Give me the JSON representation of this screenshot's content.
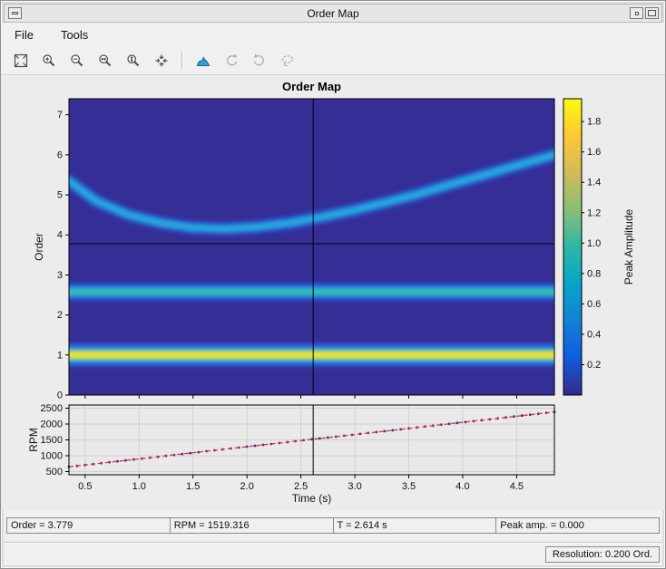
{
  "window": {
    "title": "Order Map"
  },
  "menu": {
    "items": [
      {
        "label": "File"
      },
      {
        "label": "Tools"
      }
    ]
  },
  "toolbar": {
    "buttons": [
      {
        "name": "fit-view",
        "enabled": true
      },
      {
        "name": "zoom-in",
        "enabled": true
      },
      {
        "name": "zoom-out",
        "enabled": true
      },
      {
        "name": "zoom-x",
        "enabled": true
      },
      {
        "name": "zoom-y",
        "enabled": true
      },
      {
        "name": "reset-view",
        "enabled": true
      },
      {
        "name": "colormap",
        "enabled": true
      },
      {
        "name": "rotate-ccw",
        "enabled": false
      },
      {
        "name": "rotate-cw",
        "enabled": false
      },
      {
        "name": "lasso",
        "enabled": false
      }
    ]
  },
  "status": {
    "fields": [
      {
        "name": "order",
        "text": "Order = 3.779"
      },
      {
        "name": "rpm",
        "text": "RPM = 1519.316"
      },
      {
        "name": "time",
        "text": "T = 2.614 s"
      },
      {
        "name": "peak-amp",
        "text": "Peak amp. = 0.000"
      }
    ],
    "resolution": "Resolution: 0.200 Ord."
  },
  "chart_data": [
    {
      "type": "heatmap",
      "title": "Order Map",
      "ylabel": "Order",
      "xlim": [
        0.35,
        4.85
      ],
      "ylim": [
        0,
        7.4
      ],
      "yticks": [
        0,
        1,
        2,
        3,
        4,
        5,
        6,
        7
      ],
      "xticks": [
        0.5,
        1.0,
        1.5,
        2.0,
        2.5,
        3.0,
        3.5,
        4.0,
        4.5
      ],
      "background_color": "#352e96",
      "colorbar": {
        "label": "Peak Amplitude",
        "clim": [
          0,
          1.95
        ],
        "ticks": [
          0.2,
          0.4,
          0.6,
          0.8,
          1.0,
          1.2,
          1.4,
          1.6,
          1.8
        ],
        "colors": [
          "#352a87",
          "#0f5cdd",
          "#1481d6",
          "#06a4ca",
          "#2eb7a4",
          "#87bf77",
          "#d1bb59",
          "#fec832",
          "#f9fb0e"
        ]
      },
      "crosshair": {
        "time": 2.614,
        "order": 3.779
      },
      "features": [
        {
          "kind": "horizontal-band",
          "name": "order-1-fundamental",
          "order": 1.0,
          "peak_amplitude": 1.9,
          "layers": [
            {
              "color": "#2a58d8",
              "width": 26
            },
            {
              "color": "#1fa8d8",
              "width": 16
            },
            {
              "color": "#7ccb4e",
              "width": 10
            },
            {
              "color": "#f6e81e",
              "width": 6
            }
          ]
        },
        {
          "kind": "horizontal-band",
          "name": "order-2p5-band",
          "order": 2.58,
          "peak_amplitude": 0.8,
          "layers": [
            {
              "color": "#2a58d8",
              "width": 19
            },
            {
              "color": "#1fa8d8",
              "width": 10
            },
            {
              "color": "#3cc19d",
              "width": 4
            }
          ]
        },
        {
          "kind": "curved-band",
          "name": "resonance-track",
          "peak_amplitude": 0.55,
          "layers": [
            {
              "color": "#2a52cc",
              "width": 15
            },
            {
              "color": "#27a9dd",
              "width": 7
            }
          ],
          "points": [
            [
              0.35,
              5.35
            ],
            [
              0.6,
              4.85
            ],
            [
              0.9,
              4.5
            ],
            [
              1.2,
              4.3
            ],
            [
              1.5,
              4.18
            ],
            [
              1.8,
              4.15
            ],
            [
              2.1,
              4.2
            ],
            [
              2.4,
              4.3
            ],
            [
              2.7,
              4.45
            ],
            [
              3.0,
              4.62
            ],
            [
              3.3,
              4.82
            ],
            [
              3.6,
              5.03
            ],
            [
              3.9,
              5.27
            ],
            [
              4.2,
              5.5
            ],
            [
              4.5,
              5.73
            ],
            [
              4.85,
              6.0
            ]
          ]
        }
      ]
    },
    {
      "type": "line",
      "ylabel": "RPM",
      "xlabel": "Time (s)",
      "xlim": [
        0.35,
        4.85
      ],
      "ylim": [
        400,
        2600
      ],
      "yticks": [
        500,
        1000,
        1500,
        2000,
        2500
      ],
      "xticks": [
        0.5,
        1.0,
        1.5,
        2.0,
        2.5,
        3.0,
        3.5,
        4.0,
        4.5
      ],
      "grid": true,
      "bg_color": "#e9e9e9",
      "grid_color": "#cfcfcf",
      "line_color": "#e8332a",
      "marker_color": "#2430b8",
      "points": [
        [
          0.35,
          652
        ],
        [
          0.85,
          844
        ],
        [
          1.35,
          1036
        ],
        [
          1.85,
          1228
        ],
        [
          2.35,
          1420
        ],
        [
          2.85,
          1612
        ],
        [
          3.35,
          1804
        ],
        [
          3.85,
          1996
        ],
        [
          4.35,
          2188
        ],
        [
          4.85,
          2380
        ]
      ],
      "crosshair_time": 2.614
    }
  ]
}
